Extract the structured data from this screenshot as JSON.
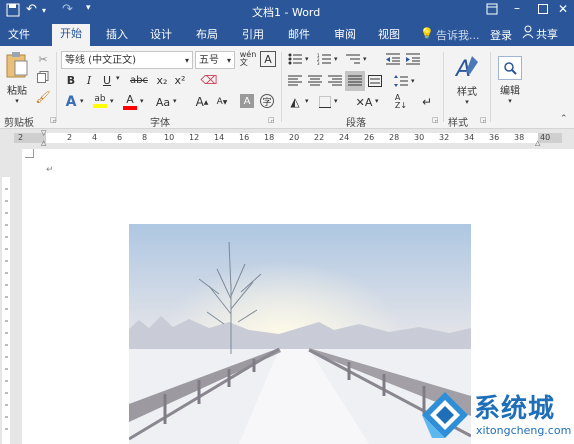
{
  "window": {
    "title": "文档1 - Word"
  },
  "titlebar_icons": {
    "undo": "undo-icon",
    "redo": "redo-icon",
    "qat": "customize-qat-icon"
  },
  "tabs": [
    {
      "label": "文件"
    },
    {
      "label": "开始"
    },
    {
      "label": "插入"
    },
    {
      "label": "设计"
    },
    {
      "label": "布局"
    },
    {
      "label": "引用"
    },
    {
      "label": "邮件"
    },
    {
      "label": "审阅"
    },
    {
      "label": "视图"
    }
  ],
  "tellme": {
    "placeholder": "告诉我..."
  },
  "account": {
    "login": "登录",
    "share": "共享"
  },
  "clipboard": {
    "paste_label": "粘贴",
    "group_label": "剪贴板"
  },
  "font": {
    "name": "等线 (中文正文)",
    "size": "五号",
    "group_label": "字体",
    "bold": "B",
    "italic": "I",
    "underline": "U",
    "strike": "abc",
    "subscript": "x₂",
    "superscript": "x²",
    "case": "Aa",
    "grow": "A",
    "shrink": "A"
  },
  "paragraph": {
    "group_label": "段落"
  },
  "styles": {
    "button_label": "样式",
    "group_label": "样式"
  },
  "editing": {
    "button_label": "编辑"
  },
  "ruler": {
    "ticks": [
      "2",
      "2",
      "4",
      "6",
      "8",
      "10",
      "12",
      "14",
      "16",
      "18",
      "20",
      "22",
      "24",
      "26",
      "28",
      "30",
      "32",
      "34",
      "36",
      "38",
      "40"
    ]
  },
  "watermark": {
    "name": "系统城",
    "url": "xitongcheng.com"
  },
  "colors": {
    "accent": "#2b579a",
    "ribbon": "#f3f3f3",
    "highlight": "#ffff00",
    "font_color": "#ff0000"
  }
}
